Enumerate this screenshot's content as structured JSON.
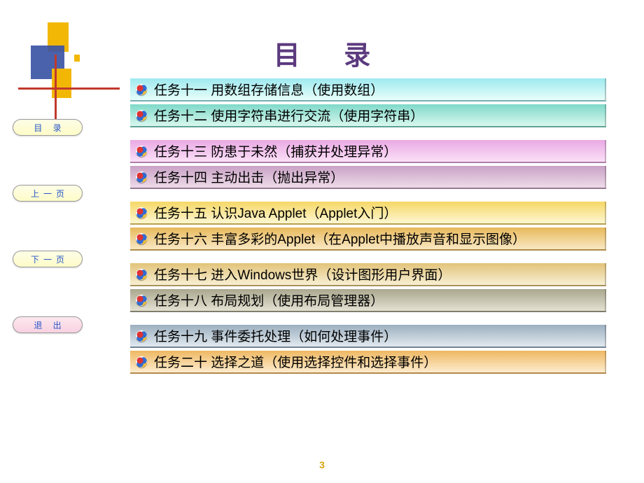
{
  "title": "目 录",
  "page_number": "3",
  "sidebar": {
    "toc": "目 录",
    "prev": "上一页",
    "next": "下一页",
    "exit": "退 出"
  },
  "items": [
    {
      "label": "任务十一  用数组存储信息（使用数组）"
    },
    {
      "label": "任务十二  使用字符串进行交流（使用字符串）"
    },
    {
      "label": "任务十三  防患于未然（捕获并处理异常）"
    },
    {
      "label": "任务十四  主动出击（抛出异常）"
    },
    {
      "label": "任务十五  认识Java Applet（Applet入门）"
    },
    {
      "label": "任务十六  丰富多彩的Applet（在Applet中播放声音和显示图像）"
    },
    {
      "label": "任务十七  进入Windows世界（设计图形用户界面）"
    },
    {
      "label": "任务十八  布局规划（使用布局管理器）"
    },
    {
      "label": "任务十九  事件委托处理（如何处理事件）"
    },
    {
      "label": "任务二十  选择之道（使用选择控件和选择事件）"
    }
  ]
}
